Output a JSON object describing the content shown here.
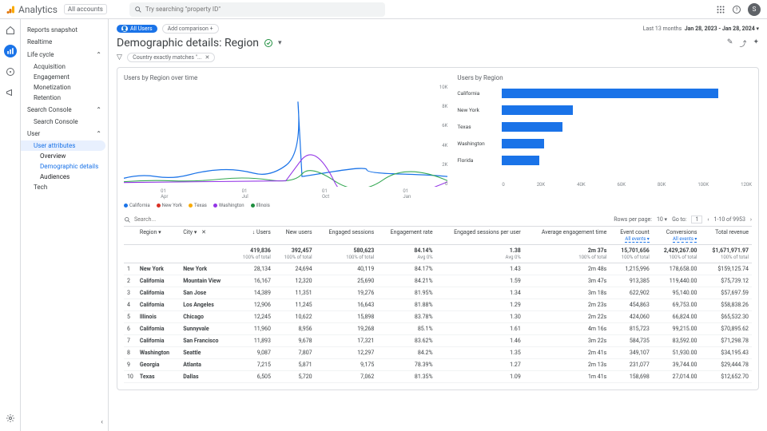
{
  "app": {
    "name": "Analytics",
    "accounts": "All accounts"
  },
  "search": {
    "placeholder": "Try searching \"property ID\""
  },
  "user_initial": "S",
  "sidebar": {
    "reports_snapshot": "Reports snapshot",
    "realtime": "Realtime",
    "lifecycle": "Life cycle",
    "lc": {
      "acquisition": "Acquisition",
      "engagement": "Engagement",
      "monetization": "Monetization",
      "retention": "Retention"
    },
    "search_console": "Search Console",
    "sc_item": "Search Console",
    "user": "User",
    "user_attributes": "User attributes",
    "ua": {
      "overview": "Overview",
      "demo": "Demographic details",
      "audiences": "Audiences"
    },
    "tech": "Tech"
  },
  "page": {
    "segment": "All Users",
    "add_comparison": "Add comparison +",
    "date_label": "Last 13 months",
    "date_range": "Jan 28, 2023 - Jan 28, 2024",
    "title": "Demographic details: Region",
    "filter": "Country exactly matches \"..."
  },
  "chart_data": {
    "line": {
      "type": "line",
      "title": "Users by Region over time",
      "ylim": [
        0,
        10000
      ],
      "yticks": [
        "10K",
        "8K",
        "6K",
        "4K",
        "2K",
        "0"
      ],
      "xticks": [
        {
          "d": "01",
          "m": "Apr"
        },
        {
          "d": "01",
          "m": "Jul"
        },
        {
          "d": "01",
          "m": "Oct"
        },
        {
          "d": "01",
          "m": "Jan"
        }
      ],
      "legend": [
        {
          "name": "California",
          "color": "#1a73e8"
        },
        {
          "name": "New York",
          "color": "#d93025"
        },
        {
          "name": "Texas",
          "color": "#f9ab00"
        },
        {
          "name": "Washington",
          "color": "#9334e6"
        },
        {
          "name": "Illinois",
          "color": "#1e8e3e"
        }
      ]
    },
    "bar": {
      "type": "bar",
      "title": "Users by Region",
      "xlim": [
        0,
        120000
      ],
      "xticks": [
        "0",
        "20K",
        "40K",
        "60K",
        "80K",
        "100K",
        "120K"
      ],
      "categories": [
        "California",
        "New York",
        "Texas",
        "Washington",
        "Florida"
      ],
      "values": [
        104000,
        34000,
        29000,
        20000,
        18000
      ]
    }
  },
  "table": {
    "search_ph": "Search...",
    "rows_per_page": "Rows per page:",
    "rpp_val": "10",
    "goto": "Go to:",
    "goto_val": "1",
    "range": "1-10 of 9953",
    "cols": {
      "region": "Region",
      "city": "City",
      "users": "↓ Users",
      "new_users": "New users",
      "eng_sess": "Engaged sessions",
      "eng_rate": "Engagement rate",
      "eng_per_user": "Engaged sessions per user",
      "avg_eng": "Average engagement time",
      "event_count": "Event count",
      "conversions": "Conversions",
      "revenue": "Total revenue",
      "all_events": "All events ▾"
    },
    "totals": {
      "users": "419,836",
      "users_sub": "100% of total",
      "new_users": "392,457",
      "new_users_sub": "100% of total",
      "eng_sess": "580,623",
      "eng_sess_sub": "100% of total",
      "eng_rate": "84.14%",
      "eng_rate_sub": "Avg 0%",
      "eng_per_user": "1.38",
      "eng_per_user_sub": "Avg 0%",
      "avg_eng": "2m 37s",
      "avg_eng_sub": "100% of total",
      "event_count": "15,701,656",
      "event_count_sub": "100% of total",
      "conversions": "2,429,267.00",
      "conversions_sub": "100% of total",
      "revenue": "$1,671,971.97",
      "revenue_sub": "100% of total"
    },
    "rows": [
      {
        "n": "1",
        "region": "New York",
        "city": "New York",
        "users": "28,134",
        "new_users": "24,694",
        "eng_sess": "40,119",
        "eng_rate": "84.17%",
        "epu": "1.43",
        "aet": "2m 48s",
        "ec": "1,215,996",
        "conv": "178,658.00",
        "rev": "$159,125.74"
      },
      {
        "n": "2",
        "region": "California",
        "city": "Mountain View",
        "users": "16,167",
        "new_users": "12,320",
        "eng_sess": "25,690",
        "eng_rate": "84.21%",
        "epu": "1.59",
        "aet": "3m 47s",
        "ec": "913,385",
        "conv": "119,440.00",
        "rev": "$75,739.12"
      },
      {
        "n": "3",
        "region": "California",
        "city": "San Jose",
        "users": "14,389",
        "new_users": "11,351",
        "eng_sess": "19,276",
        "eng_rate": "81.95%",
        "epu": "1.34",
        "aet": "3m 18s",
        "ec": "622,902",
        "conv": "95,140.00",
        "rev": "$57,697.59"
      },
      {
        "n": "4",
        "region": "California",
        "city": "Los Angeles",
        "users": "12,906",
        "new_users": "11,245",
        "eng_sess": "16,643",
        "eng_rate": "81.88%",
        "epu": "1.29",
        "aet": "2m 23s",
        "ec": "454,863",
        "conv": "69,753.00",
        "rev": "$58,838.26"
      },
      {
        "n": "5",
        "region": "Illinois",
        "city": "Chicago",
        "users": "12,245",
        "new_users": "10,622",
        "eng_sess": "15,898",
        "eng_rate": "83.78%",
        "epu": "1.30",
        "aet": "2m 22s",
        "ec": "424,060",
        "conv": "66,824.00",
        "rev": "$65,532.30"
      },
      {
        "n": "6",
        "region": "California",
        "city": "Sunnyvale",
        "users": "11,960",
        "new_users": "8,956",
        "eng_sess": "19,268",
        "eng_rate": "85.1%",
        "epu": "1.61",
        "aet": "4m 16s",
        "ec": "815,723",
        "conv": "99,215.00",
        "rev": "$70,895.62"
      },
      {
        "n": "7",
        "region": "California",
        "city": "San Francisco",
        "users": "11,893",
        "new_users": "9,678",
        "eng_sess": "17,321",
        "eng_rate": "83.62%",
        "epu": "1.46",
        "aet": "3m 22s",
        "ec": "584,735",
        "conv": "83,592.00",
        "rev": "$71,298.78"
      },
      {
        "n": "8",
        "region": "Washington",
        "city": "Seattle",
        "users": "9,087",
        "new_users": "7,807",
        "eng_sess": "12,297",
        "eng_rate": "84.2%",
        "epu": "1.35",
        "aet": "2m 41s",
        "ec": "349,107",
        "conv": "51,930.00",
        "rev": "$34,195.43"
      },
      {
        "n": "9",
        "region": "Georgia",
        "city": "Atlanta",
        "users": "7,215",
        "new_users": "5,871",
        "eng_sess": "9,175",
        "eng_rate": "78.39%",
        "epu": "1.27",
        "aet": "2m 13s",
        "ec": "231,077",
        "conv": "39,744.00",
        "rev": "$29,444.78"
      },
      {
        "n": "10",
        "region": "Texas",
        "city": "Dallas",
        "users": "6,505",
        "new_users": "5,720",
        "eng_sess": "7,062",
        "eng_rate": "81.35%",
        "epu": "1.09",
        "aet": "1m 41s",
        "ec": "158,698",
        "conv": "27,014.00",
        "rev": "$12,652.70"
      }
    ]
  }
}
